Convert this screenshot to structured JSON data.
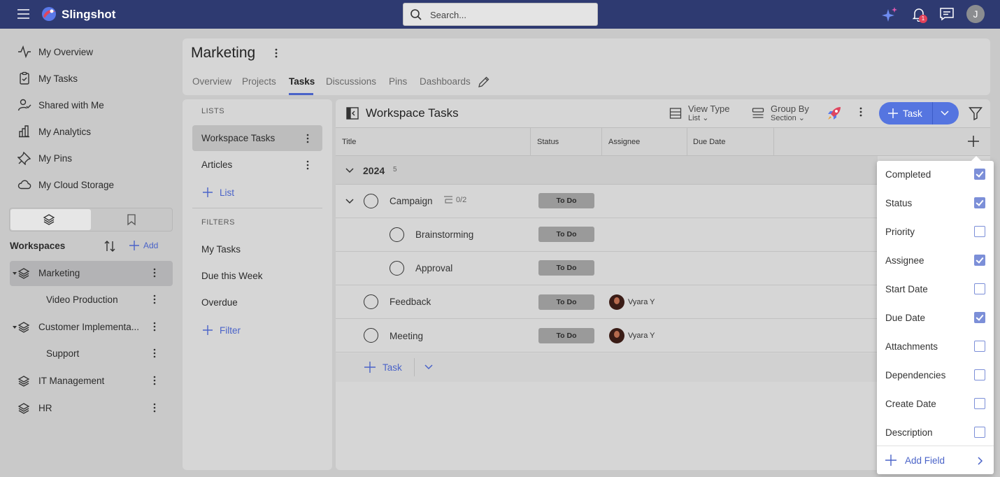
{
  "app": {
    "brand": "Slingshot",
    "search_placeholder": "Search...",
    "notification_count": "1",
    "user_initial": "J"
  },
  "sidebar": {
    "nav": [
      {
        "label": "My Overview",
        "icon": "activity-icon"
      },
      {
        "label": "My Tasks",
        "icon": "clipboard-check-icon"
      },
      {
        "label": "Shared with Me",
        "icon": "user-check-icon"
      },
      {
        "label": "My Analytics",
        "icon": "bar-chart-icon"
      },
      {
        "label": "My Pins",
        "icon": "pin-icon"
      },
      {
        "label": "My Cloud Storage",
        "icon": "cloud-icon"
      }
    ],
    "workspaces_title": "Workspaces",
    "add_label": "Add",
    "workspaces": [
      {
        "label": "Marketing",
        "selected": true,
        "level": 0,
        "expandable": true
      },
      {
        "label": "Video Production",
        "selected": false,
        "level": 1,
        "expandable": false
      },
      {
        "label": "Customer Implementa...",
        "selected": false,
        "level": 0,
        "expandable": true
      },
      {
        "label": "Support",
        "selected": false,
        "level": 1,
        "expandable": false
      },
      {
        "label": "IT Management",
        "selected": false,
        "level": 0,
        "expandable": false
      },
      {
        "label": "HR",
        "selected": false,
        "level": 0,
        "expandable": false
      }
    ]
  },
  "header": {
    "title": "Marketing",
    "tabs": [
      "Overview",
      "Projects",
      "Tasks",
      "Discussions",
      "Pins",
      "Dashboards"
    ],
    "active_tab": "Tasks"
  },
  "lists_panel": {
    "lists_label": "LISTS",
    "lists": [
      "Workspace Tasks",
      "Articles"
    ],
    "add_list_label": "List",
    "filters_label": "FILTERS",
    "filters": [
      "My Tasks",
      "Due this Week",
      "Overdue"
    ],
    "add_filter_label": "Filter"
  },
  "main": {
    "title": "Workspace Tasks",
    "view_type_label": "View Type",
    "view_type_value": "List",
    "group_by_label": "Group By",
    "group_by_value": "Section",
    "task_button_label": "Task",
    "columns": [
      "Title",
      "Status",
      "Assignee",
      "Due Date"
    ],
    "group": {
      "label": "2024",
      "count": "5"
    },
    "rows": [
      {
        "title": "Campaign",
        "status": "To Do",
        "assignee": "",
        "subtasks": "0/2",
        "level": 0
      },
      {
        "title": "Brainstorming",
        "status": "To Do",
        "assignee": "",
        "level": 1
      },
      {
        "title": "Approval",
        "status": "To Do",
        "assignee": "",
        "level": 1
      },
      {
        "title": "Feedback",
        "status": "To Do",
        "assignee": "Vyara Y",
        "level": 0
      },
      {
        "title": "Meeting",
        "status": "To Do",
        "assignee": "Vyara Y",
        "level": 0
      }
    ],
    "add_task_label": "Task"
  },
  "field_menu": {
    "items": [
      {
        "label": "Completed",
        "checked": true
      },
      {
        "label": "Status",
        "checked": true
      },
      {
        "label": "Priority",
        "checked": false
      },
      {
        "label": "Assignee",
        "checked": true
      },
      {
        "label": "Start Date",
        "checked": false
      },
      {
        "label": "Due Date",
        "checked": true
      },
      {
        "label": "Attachments",
        "checked": false
      },
      {
        "label": "Dependencies",
        "checked": false
      },
      {
        "label": "Create Date",
        "checked": false
      },
      {
        "label": "Description",
        "checked": false
      }
    ],
    "add_field_label": "Add Field"
  },
  "colors": {
    "topbar": "#2e3a71",
    "accent": "#4a63c8",
    "primary_button": "#5575e0",
    "checkbox": "#7c8fd8",
    "status_badge": "#9a9a9a"
  }
}
